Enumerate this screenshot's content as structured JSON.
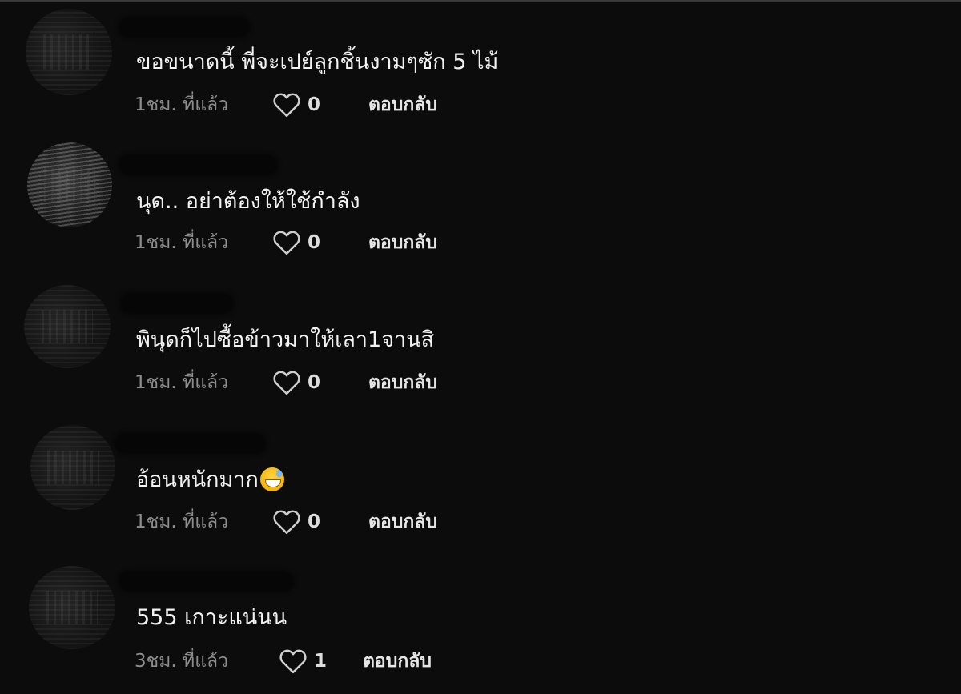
{
  "comments": [
    {
      "text": "ขอขนาดนี้ พี่จะเปย์ลูกชิ้นงามๆซัก 5 ไม้",
      "time": "1ชม. ที่แล้ว",
      "likes": "0",
      "reply_label": "ตอบกลับ",
      "has_emoji": false
    },
    {
      "text": "นุด.. อย่าต้องให้ใช้กำลัง",
      "time": "1ชม. ที่แล้ว",
      "likes": "0",
      "reply_label": "ตอบกลับ",
      "has_emoji": false
    },
    {
      "text": "พินุดก็ไปซื้อข้าวมาให้เลา1จานสิ",
      "time": "1ชม. ที่แล้ว",
      "likes": "0",
      "reply_label": "ตอบกลับ",
      "has_emoji": false
    },
    {
      "text": "อ้อนหนักมาก",
      "time": "1ชม. ที่แล้ว",
      "likes": "0",
      "reply_label": "ตอบกลับ",
      "has_emoji": true,
      "emoji": "grinning-face-with-sweat"
    },
    {
      "text": "555 เกาะแน่นน",
      "time": "3ชม. ที่แล้ว",
      "likes": "1",
      "reply_label": "ตอบกลับ",
      "has_emoji": false
    }
  ],
  "colors": {
    "background": "#0c0c0c",
    "text": "#f2f2f2",
    "muted": "#8d8d8d"
  },
  "icons": {
    "like": "heart-outline-icon"
  }
}
